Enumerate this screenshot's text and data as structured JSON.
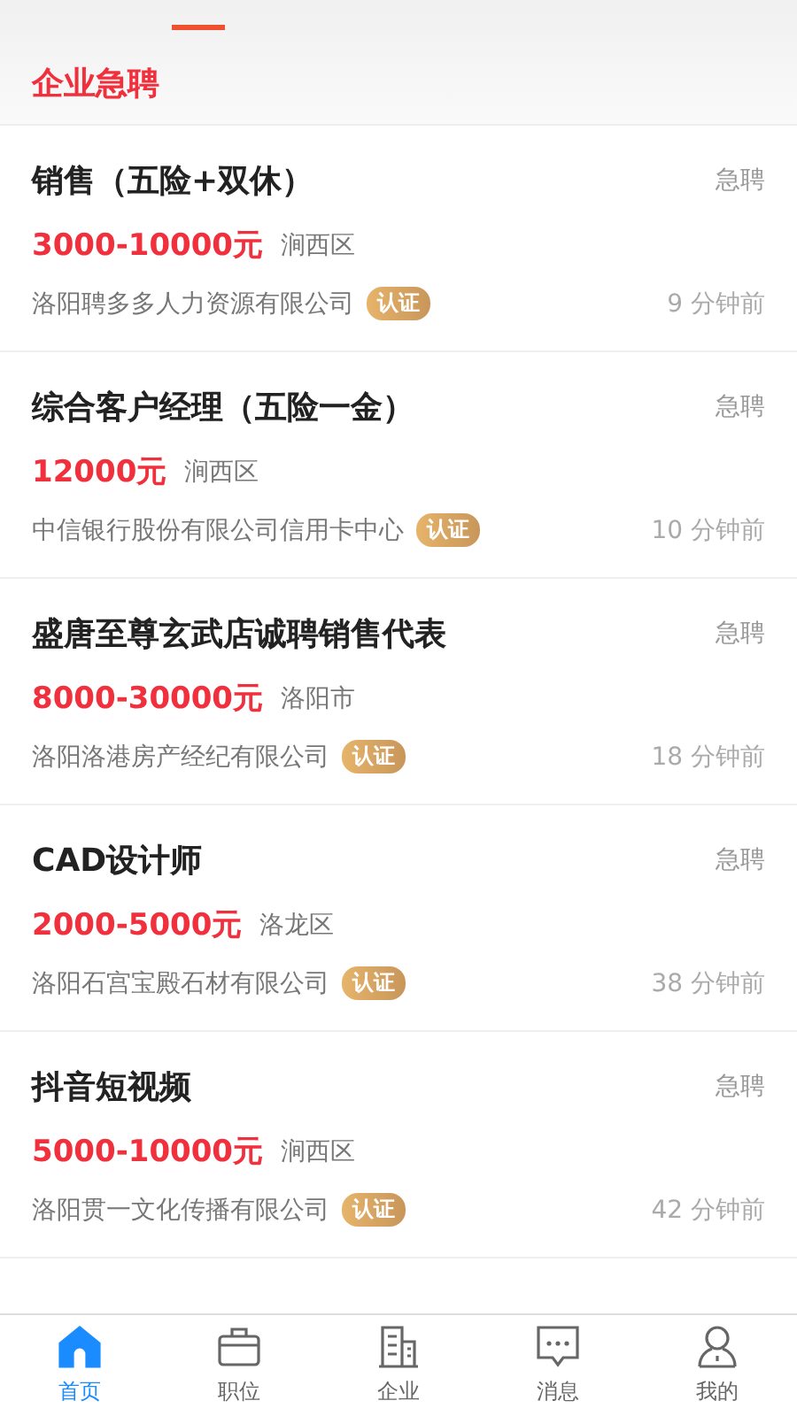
{
  "section_title": "企业急聘",
  "jobs": [
    {
      "title": "销售（五险+双休）",
      "tag": "急聘",
      "salary": "3000-10000元",
      "area": "涧西区",
      "company": "洛阳聘多多人力资源有限公司",
      "verified": true,
      "verified_label": "认证",
      "time": "9 分钟前"
    },
    {
      "title": "综合客户经理（五险一金）",
      "tag": "急聘",
      "salary": "12000元",
      "area": "涧西区",
      "company": "中信银行股份有限公司信用卡中心",
      "verified": true,
      "verified_label": "认证",
      "time": "10 分钟前"
    },
    {
      "title": "盛唐至尊玄武店诚聘销售代表",
      "tag": "急聘",
      "salary": "8000-30000元",
      "area": "洛阳市",
      "company": "洛阳洛港房产经纪有限公司",
      "verified": true,
      "verified_label": "认证",
      "time": "18 分钟前"
    },
    {
      "title": "CAD设计师",
      "tag": "急聘",
      "salary": "2000-5000元",
      "area": "洛龙区",
      "company": "洛阳石宫宝殿石材有限公司",
      "verified": true,
      "verified_label": "认证",
      "time": "38 分钟前"
    },
    {
      "title": "抖音短视频",
      "tag": "急聘",
      "salary": "5000-10000元",
      "area": "涧西区",
      "company": "洛阳贯一文化传播有限公司",
      "verified": true,
      "verified_label": "认证",
      "time": "42 分钟前"
    }
  ],
  "tab_bar": [
    {
      "label": "首页",
      "selected": true
    },
    {
      "label": "职位",
      "selected": false
    },
    {
      "label": "企业",
      "selected": false
    },
    {
      "label": "消息",
      "selected": false
    },
    {
      "label": "我的",
      "selected": false
    }
  ]
}
